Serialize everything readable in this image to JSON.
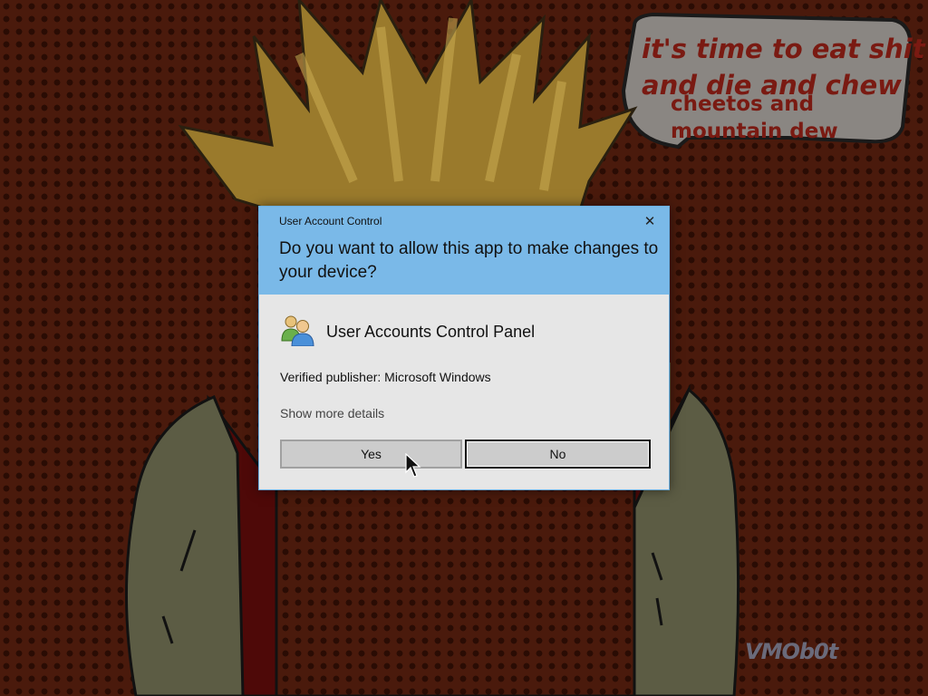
{
  "wallpaper": {
    "speech_line_1": "it's time to eat shit",
    "speech_line_2": "and die and chew",
    "speech_line_3": "cheetos and",
    "speech_line_4": "mountain dew",
    "watermark": "VMOb0t",
    "colors": {
      "background": "#4a1a0c",
      "shirt": "#5a0c0a",
      "skin": "#6a6a52",
      "hair": "#c8a040"
    }
  },
  "uac": {
    "title": "User Account Control",
    "close_icon": "close-icon",
    "question": "Do you want to allow this app to make changes to your device?",
    "app_icon": "users-icon",
    "app_name": "User Accounts Control Panel",
    "publisher": "Verified publisher: Microsoft Windows",
    "show_details": "Show more details",
    "yes_label": "Yes",
    "no_label": "No",
    "colors": {
      "header": "#7ab9e8",
      "body": "#e6e6e6",
      "button": "#cccccc"
    }
  }
}
